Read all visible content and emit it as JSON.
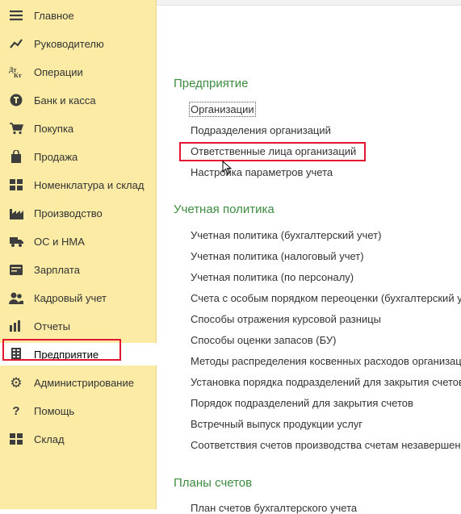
{
  "sidebar": {
    "items": [
      {
        "label": "Главное",
        "icon": "menu-icon"
      },
      {
        "label": "Руководителю",
        "icon": "chart-trend-icon"
      },
      {
        "label": "Операции",
        "icon": "debit-credit-icon"
      },
      {
        "label": "Банк и касса",
        "icon": "coin-icon"
      },
      {
        "label": "Покупка",
        "icon": "cart-icon"
      },
      {
        "label": "Продажа",
        "icon": "bag-icon"
      },
      {
        "label": "Номенклатура и склад",
        "icon": "grid-icon"
      },
      {
        "label": "Производство",
        "icon": "factory-icon"
      },
      {
        "label": "ОС и НМА",
        "icon": "truck-icon"
      },
      {
        "label": "Зарплата",
        "icon": "wallet-icon"
      },
      {
        "label": "Кадровый учет",
        "icon": "people-icon"
      },
      {
        "label": "Отчеты",
        "icon": "bar-chart-icon"
      },
      {
        "label": "Предприятие",
        "icon": "building-icon",
        "active": true
      },
      {
        "label": "Администрирование",
        "icon": "gear-icon"
      },
      {
        "label": "Помощь",
        "icon": "question-icon"
      },
      {
        "label": "Склад",
        "icon": "warehouse-icon"
      }
    ]
  },
  "main": {
    "sections": [
      {
        "title": "Предприятие",
        "links": [
          "Организации",
          "Подразделения организаций",
          "Ответственные лица организаций",
          "Настройка параметров учета"
        ]
      },
      {
        "title": "Учетная политика",
        "links": [
          "Учетная политика (бухгалтерский учет)",
          "Учетная политика (налоговый учет)",
          "Учетная политика (по персоналу)",
          "Счета с особым порядком переоценки (бухгалтерский у",
          "Способы отражения курсовой разницы",
          "Способы оценки запасов (БУ)",
          "Методы распределения косвенных расходов организаци",
          "Установка порядка подразделений для закрытия счетов",
          "Порядок подразделений для закрытия счетов",
          "Встречный выпуск продукции услуг",
          "Соответствия счетов производства счетам незавершенн"
        ]
      },
      {
        "title": "Планы счетов",
        "links": [
          "План счетов бухгалтерского учета"
        ]
      }
    ]
  },
  "colors": {
    "sidebar_bg": "#fbeba5",
    "section_title": "#3d8c40",
    "highlight": "#e2162f"
  }
}
